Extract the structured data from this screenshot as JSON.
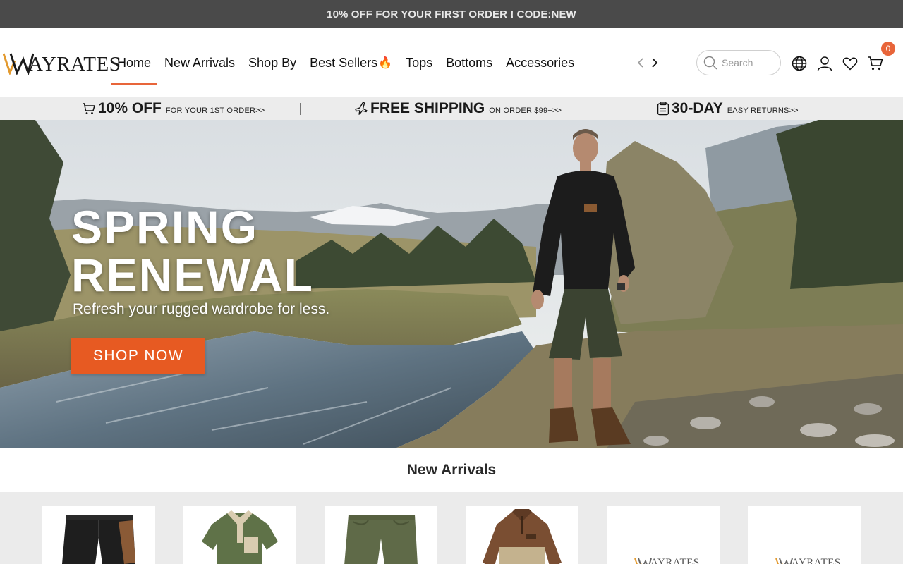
{
  "announcement": "10% OFF FOR YOUR FIRST ORDER ! CODE:NEW",
  "logo": {
    "text": "AYRATES"
  },
  "nav": {
    "items": [
      {
        "label": "Home",
        "active": true
      },
      {
        "label": "New Arrivals"
      },
      {
        "label": "Shop By"
      },
      {
        "label": "Best Sellers"
      },
      {
        "label": "Tops"
      },
      {
        "label": "Bottoms"
      },
      {
        "label": "Accessories"
      }
    ],
    "best_sellers_icon": "fire-icon"
  },
  "search": {
    "placeholder": "Search"
  },
  "cart": {
    "count": "0"
  },
  "promo": [
    {
      "big": "10% OFF",
      "small": "FOR YOUR 1ST ORDER>>",
      "icon": "cart-icon"
    },
    {
      "big": "FREE SHIPPING",
      "small": "ON ORDER $99+>>",
      "icon": "plane-icon"
    },
    {
      "big": "30-DAY",
      "small": "EASY RETURNS>>",
      "icon": "return-box-icon"
    }
  ],
  "hero": {
    "title_line1": "SPRING",
    "title_line2": "RENEWAL",
    "subtitle": "Refresh your rugged wardrobe for less.",
    "button": "SHOP NOW"
  },
  "new_arrivals": {
    "title": "New Arrivals",
    "products": [
      {
        "type": "black-shorts"
      },
      {
        "type": "green-polo"
      },
      {
        "type": "olive-shorts"
      },
      {
        "type": "brown-pullover"
      },
      {
        "type": "logo-placeholder",
        "logo_text": "AYRATES"
      },
      {
        "type": "logo-placeholder",
        "logo_text": "AYRATES"
      }
    ]
  },
  "colors": {
    "accent": "#e8653a",
    "announce_bg": "#4a4a4a",
    "button": "#e75a22"
  }
}
